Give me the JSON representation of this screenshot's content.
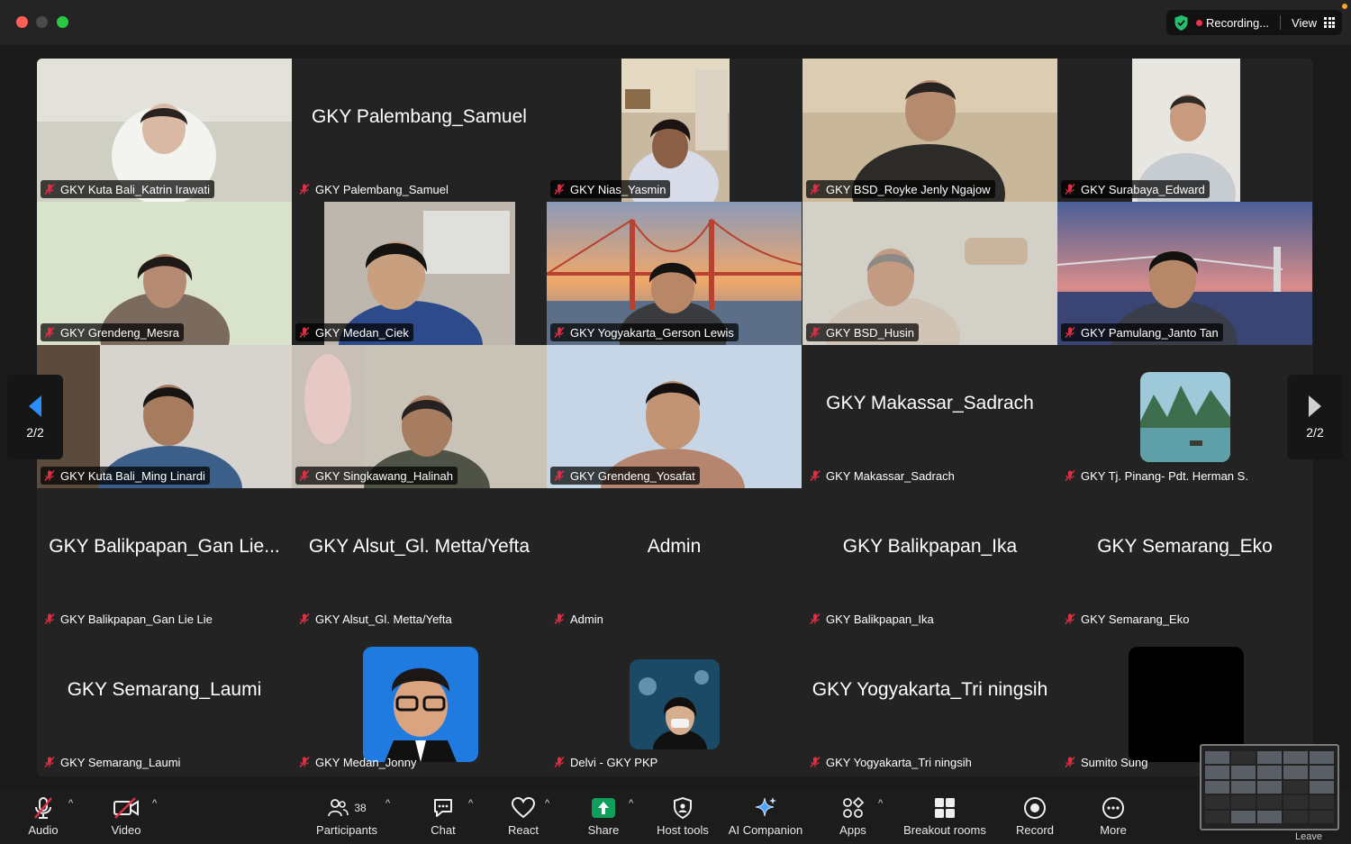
{
  "window": {
    "recording_label": "Recording...",
    "view_label": "View"
  },
  "gallery": {
    "page_indicator_left": "2/2",
    "page_indicator_right": "2/2",
    "tiles": [
      {
        "label": "GKY Kuta Bali_Katrin Irawati",
        "big_name": "",
        "mic_muted": true,
        "has_video": true
      },
      {
        "label": "GKY Palembang_Samuel",
        "big_name": "GKY Palembang_Samuel",
        "mic_muted": true,
        "has_video": false
      },
      {
        "label": "GKY Nias_Yasmin",
        "big_name": "",
        "mic_muted": true,
        "has_video": true
      },
      {
        "label": "GKY BSD_Royke Jenly Ngajow",
        "big_name": "",
        "mic_muted": true,
        "has_video": true
      },
      {
        "label": "GKY Surabaya_Edward",
        "big_name": "",
        "mic_muted": true,
        "has_video": true
      },
      {
        "label": "GKY Grendeng_Mesra",
        "big_name": "",
        "mic_muted": true,
        "has_video": true
      },
      {
        "label": "GKY Medan_Ciek",
        "big_name": "",
        "mic_muted": true,
        "has_video": true
      },
      {
        "label": "GKY Yogyakarta_Gerson Lewis",
        "big_name": "",
        "mic_muted": true,
        "has_video": true
      },
      {
        "label": "GKY BSD_Husin",
        "big_name": "",
        "mic_muted": true,
        "has_video": true
      },
      {
        "label": "GKY Pamulang_Janto Tan",
        "big_name": "",
        "mic_muted": true,
        "has_video": true
      },
      {
        "label": "GKY Kuta Bali_Ming Linardi",
        "big_name": "",
        "mic_muted": true,
        "has_video": true
      },
      {
        "label": "GKY Singkawang_Halinah",
        "big_name": "",
        "mic_muted": true,
        "has_video": true
      },
      {
        "label": "GKY Grendeng_Yosafat",
        "big_name": "",
        "mic_muted": true,
        "has_video": true
      },
      {
        "label": "GKY Makassar_Sadrach",
        "big_name": "GKY Makassar_Sadrach",
        "mic_muted": true,
        "has_video": false
      },
      {
        "label": "GKY Tj. Pinang- Pdt. Herman S.",
        "big_name": "",
        "mic_muted": true,
        "has_video": false
      },
      {
        "label": "GKY Balikpapan_Gan Lie Lie",
        "big_name": "GKY Balikpapan_Gan Lie...",
        "mic_muted": true,
        "has_video": false
      },
      {
        "label": "GKY Alsut_Gl. Metta/Yefta",
        "big_name": "GKY Alsut_Gl. Metta/Yefta",
        "mic_muted": true,
        "has_video": false
      },
      {
        "label": "Admin",
        "big_name": "Admin",
        "mic_muted": true,
        "has_video": false
      },
      {
        "label": "GKY Balikpapan_Ika",
        "big_name": "GKY Balikpapan_Ika",
        "mic_muted": true,
        "has_video": false
      },
      {
        "label": "GKY Semarang_Eko",
        "big_name": "GKY Semarang_Eko",
        "mic_muted": true,
        "has_video": false
      },
      {
        "label": "GKY Semarang_Laumi",
        "big_name": "GKY Semarang_Laumi",
        "mic_muted": true,
        "has_video": false
      },
      {
        "label": "GKY Medan_Jonny",
        "big_name": "",
        "mic_muted": true,
        "has_video": false
      },
      {
        "label": "Delvi - GKY PKP",
        "big_name": "",
        "mic_muted": true,
        "has_video": false
      },
      {
        "label": "GKY Yogyakarta_Tri ningsih",
        "big_name": "GKY Yogyakarta_Tri ningsih",
        "mic_muted": true,
        "has_video": false
      },
      {
        "label": "Sumito Sung",
        "big_name": "",
        "mic_muted": true,
        "has_video": false
      }
    ]
  },
  "toolbar": {
    "audio": "Audio",
    "video": "Video",
    "participants": "Participants",
    "participant_count": "38",
    "chat": "Chat",
    "react": "React",
    "share": "Share",
    "host_tools": "Host tools",
    "ai_companion": "AI Companion",
    "apps": "Apps",
    "breakout_rooms": "Breakout rooms",
    "record": "Record",
    "more": "More",
    "leave_partial": "Leave"
  },
  "colors": {
    "share_green": "#0e9f5a",
    "muted_red": "#e02f44",
    "pager_arrow_blue": "#2d8cff",
    "recording_red": "#e8334a",
    "shield_green": "#23c16b"
  },
  "icons": [
    "microphone-muted-icon",
    "video-off-icon",
    "participants-icon",
    "chat-icon",
    "heart-icon",
    "share-up-arrow-icon",
    "shield-icon",
    "sparkle-icon",
    "apps-icon",
    "breakout-grid-icon",
    "record-icon",
    "more-dots-icon",
    "view-grid-icon",
    "chevron-left-icon",
    "chevron-right-icon"
  ]
}
